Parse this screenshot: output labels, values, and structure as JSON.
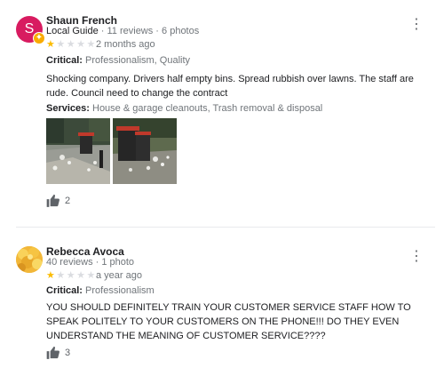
{
  "reviews": [
    {
      "avatar_letter": "S",
      "name": "Shaun French",
      "meta_badge": "Local Guide",
      "meta_rest": " · 11 reviews · 6 photos",
      "rating": 1,
      "time_ago": "2 months ago",
      "critical_label": "Critical:",
      "critical_value": "Professionalism, Quality",
      "text": "Shocking company. Drivers half empty bins. Spread rubbish over lawns. The staff are rude. Council need to change the contract",
      "services_label": "Services:",
      "services_value": "House & garage cleanouts, Trash removal & disposal",
      "likes": "2"
    },
    {
      "name": "Rebecca Avoca",
      "meta": "40 reviews · 1 photo",
      "rating": 1,
      "time_ago": "a year ago",
      "critical_label": "Critical:",
      "critical_value": "Professionalism",
      "text": "YOU SHOULD DEFINITELY TRAIN YOUR CUSTOMER SERVICE STAFF HOW TO SPEAK POLITELY TO YOUR CUSTOMERS ON THE PHONE!!! DO THEY EVEN UNDERSTAND THE MEANING OF CUSTOMER SERVICE????",
      "likes": "3"
    }
  ],
  "colors": {
    "avatar1": "#d81b60",
    "guide_badge": "#f9ab00",
    "star_on": "#fbbc04",
    "star_off": "#dadce0",
    "bin_lid": "#c0392b"
  },
  "icons": {
    "menu": "more-vert-icon",
    "like": "thumb-up-icon",
    "guide": "local-guide-badge-icon"
  }
}
